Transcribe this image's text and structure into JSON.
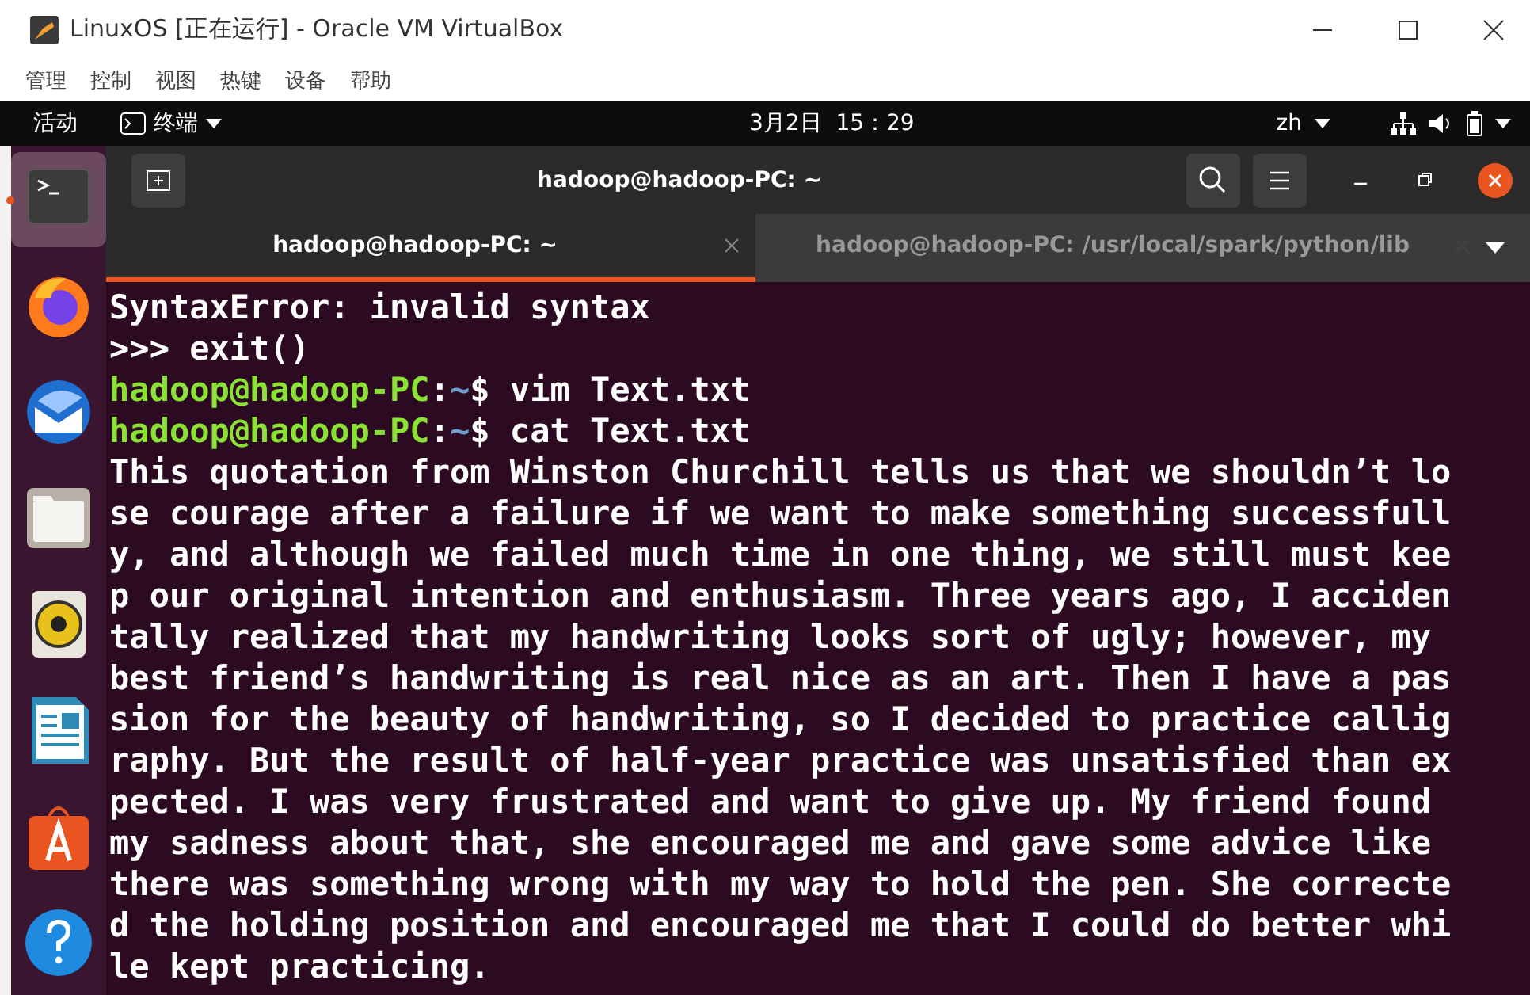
{
  "window": {
    "title": "LinuxOS [正在运行] - Oracle VM VirtualBox"
  },
  "menu": [
    "管理",
    "控制",
    "视图",
    "热键",
    "设备",
    "帮助"
  ],
  "top_bar": {
    "activities": "活动",
    "app_menu": "终端",
    "clock": "3月2日  15：29",
    "input_method": "zh"
  },
  "dock": [
    {
      "kind": "terminal",
      "selected": true
    },
    {
      "kind": "firefox",
      "selected": false
    },
    {
      "kind": "thunderbird",
      "selected": false
    },
    {
      "kind": "files",
      "selected": false
    },
    {
      "kind": "rhythmbox",
      "selected": false
    },
    {
      "kind": "writer",
      "selected": false
    },
    {
      "kind": "software",
      "selected": false
    },
    {
      "kind": "help",
      "selected": false
    }
  ],
  "terminal": {
    "title": "hadoop@hadoop-PC: ~",
    "tabs": [
      {
        "label": "hadoop@hadoop-PC: ~",
        "selected": true
      },
      {
        "label": "hadoop@hadoop-PC: /usr/local/spark/python/lib",
        "selected": false
      }
    ],
    "lines": [
      {
        "kind": "output",
        "text": "SyntaxError: invalid syntax"
      },
      {
        "kind": "output",
        "text": ">>> exit()"
      },
      {
        "kind": "prompt",
        "user": "hadoop@hadoop-PC",
        "sep": ":",
        "path": "~",
        "command": "$ vim Text.txt"
      },
      {
        "kind": "prompt",
        "user": "hadoop@hadoop-PC",
        "sep": ":",
        "path": "~",
        "command": "$ cat Text.txt"
      },
      {
        "kind": "output",
        "text": "This quotation from Winston Churchill tells us that we shouldn’t lo"
      },
      {
        "kind": "output",
        "text": "se courage after a failure if we want to make something successfull"
      },
      {
        "kind": "output",
        "text": "y, and although we failed much time in one thing, we still must kee"
      },
      {
        "kind": "output",
        "text": "p our original intention and enthusiasm. Three years ago, I acciden"
      },
      {
        "kind": "output",
        "text": "tally realized that my handwriting looks sort of ugly; however, my"
      },
      {
        "kind": "output",
        "text": "best friend’s handwriting is real nice as an art. Then I have a pas"
      },
      {
        "kind": "output",
        "text": "sion for the beauty of handwriting, so I decided to practice callig"
      },
      {
        "kind": "output",
        "text": "raphy. But the result of half-year practice was unsatisfied than ex"
      },
      {
        "kind": "output",
        "text": "pected. I was very frustrated and want to give up. My friend found"
      },
      {
        "kind": "output",
        "text": "my sadness about that, she encouraged me and gave some advice like"
      },
      {
        "kind": "output",
        "text": "there was something wrong with my way to hold the pen. She correcte"
      },
      {
        "kind": "output",
        "text": "d the holding position and encouraged me that I could do better whi"
      },
      {
        "kind": "output",
        "text": "le kept practicing."
      }
    ]
  }
}
